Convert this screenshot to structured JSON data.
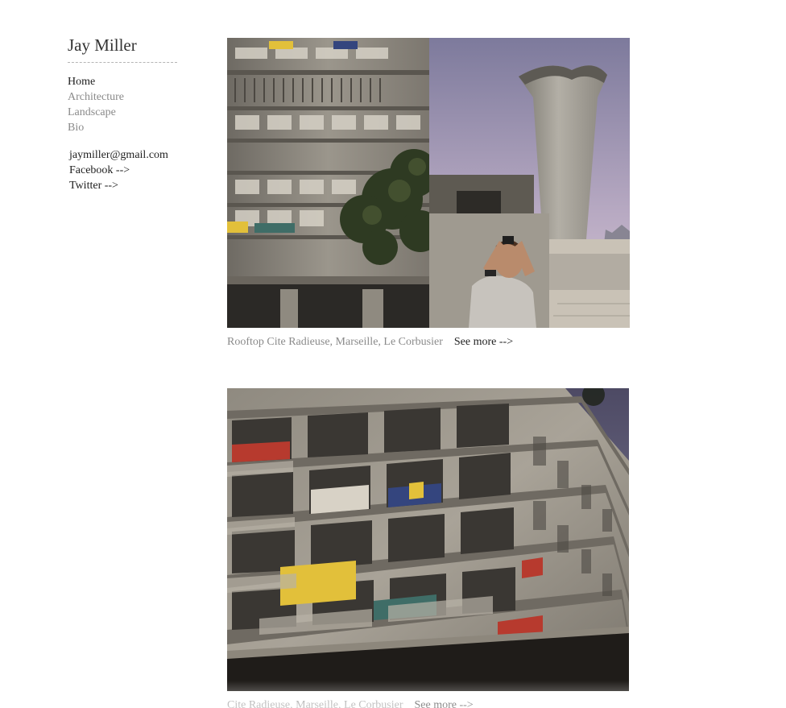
{
  "site": {
    "title": "Jay Miller"
  },
  "nav": {
    "items": [
      {
        "label": "Home"
      },
      {
        "label": "Architecture"
      },
      {
        "label": "Landscape"
      },
      {
        "label": "Bio"
      }
    ]
  },
  "contact": {
    "email": "jaymiller@gmail.com",
    "facebook": "Facebook -->",
    "twitter": "Twitter -->"
  },
  "posts": [
    {
      "caption": "Rooftop Cite Radieuse, Marseille, Le Corbusier",
      "more": "See more -->"
    },
    {
      "caption": "Cite Radieuse, Marseille, Le Corbusier",
      "more": "See more -->"
    }
  ],
  "colors": {
    "nav_active": "#1e1e1e",
    "nav_inactive": "#8a8a8a",
    "caption": "#8a8a8a",
    "facade_red": "#b73a2e",
    "facade_yellow": "#e2c03a",
    "facade_blue": "#34457e",
    "facade_green": "#3f6d67"
  }
}
